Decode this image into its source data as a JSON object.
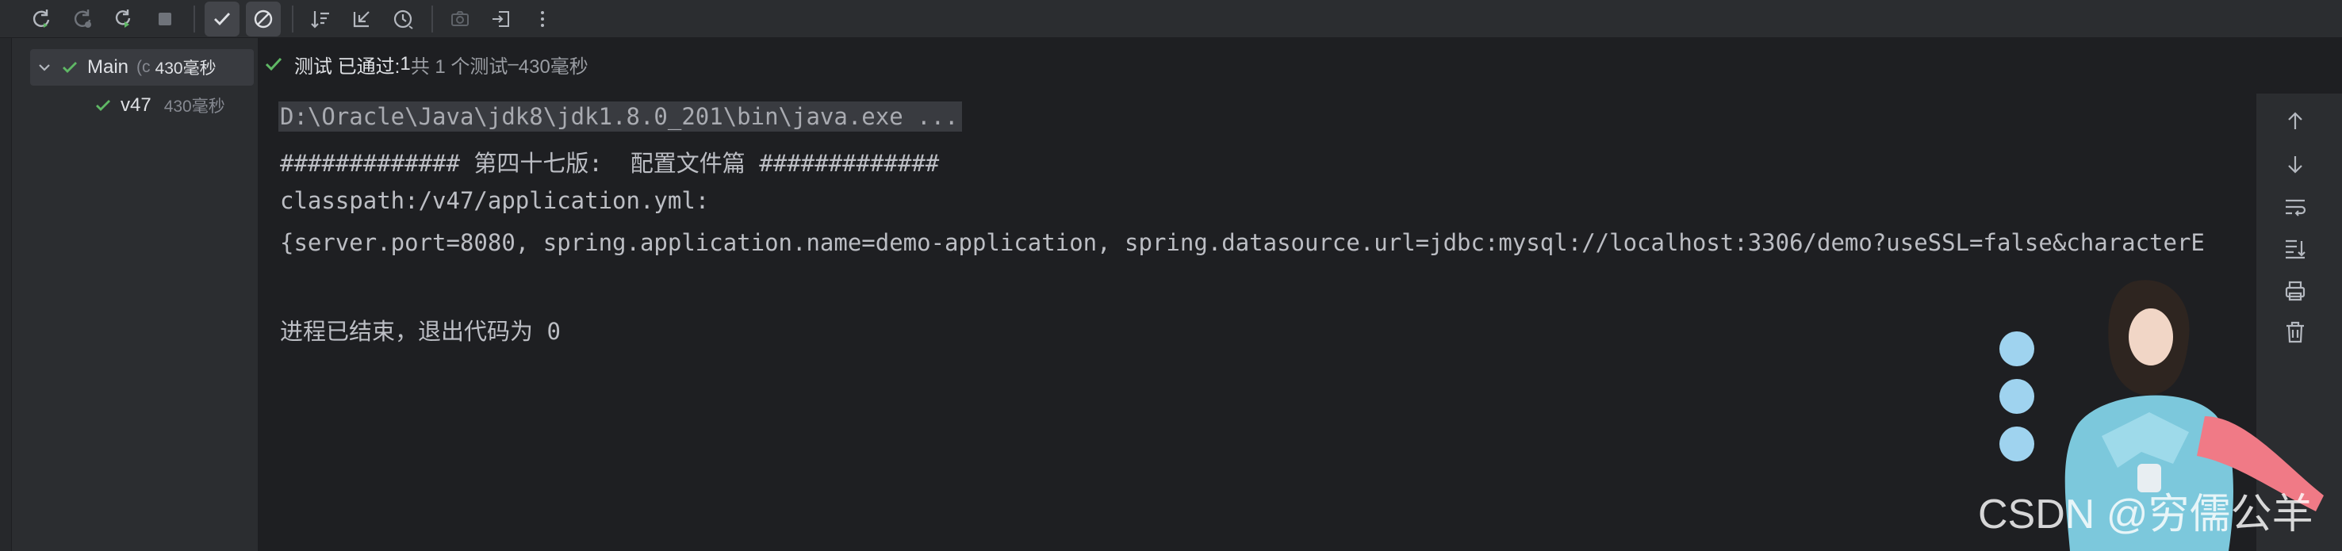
{
  "toolbar": {
    "icons": [
      "rerun-icon",
      "rerun-failed-icon",
      "toggle-autotest-icon",
      "stop-icon",
      "show-passed-icon",
      "show-ignored-icon",
      "sort-icon",
      "collapse-icon",
      "history-icon",
      "screenshot-icon",
      "import-icon",
      "more-icon"
    ]
  },
  "tree": {
    "root": {
      "label": "Main",
      "class_hint": "(c",
      "time": "430毫秒"
    },
    "child": {
      "label": "v47",
      "time": "430毫秒"
    }
  },
  "status": {
    "prefix": "测试 已通过: ",
    "passed": "1",
    "total": "共 1 个测试",
    "dash": " – ",
    "duration": "430毫秒"
  },
  "console": {
    "lines": [
      "D:\\Oracle\\Java\\jdk8\\jdk1.8.0_201\\bin\\java.exe ...",
      "############# 第四十七版:  配置文件篇 #############",
      "classpath:/v47/application.yml:",
      "{server.port=8080, spring.application.name=demo-application, spring.datasource.url=jdbc:mysql://localhost:3306/demo?useSSL=false&characterE",
      "进程已结束，退出代码为 0"
    ]
  },
  "right_bar": {
    "icons": [
      "up-arrow-icon",
      "down-arrow-icon",
      "soft-wrap-icon",
      "scroll-to-end-icon",
      "print-icon",
      "trash-icon"
    ]
  },
  "watermark": "CSDN @穷儒公羊",
  "colors": {
    "pass_green": "#5fb865",
    "bg": "#1e1f22",
    "panel": "#2b2d30"
  }
}
